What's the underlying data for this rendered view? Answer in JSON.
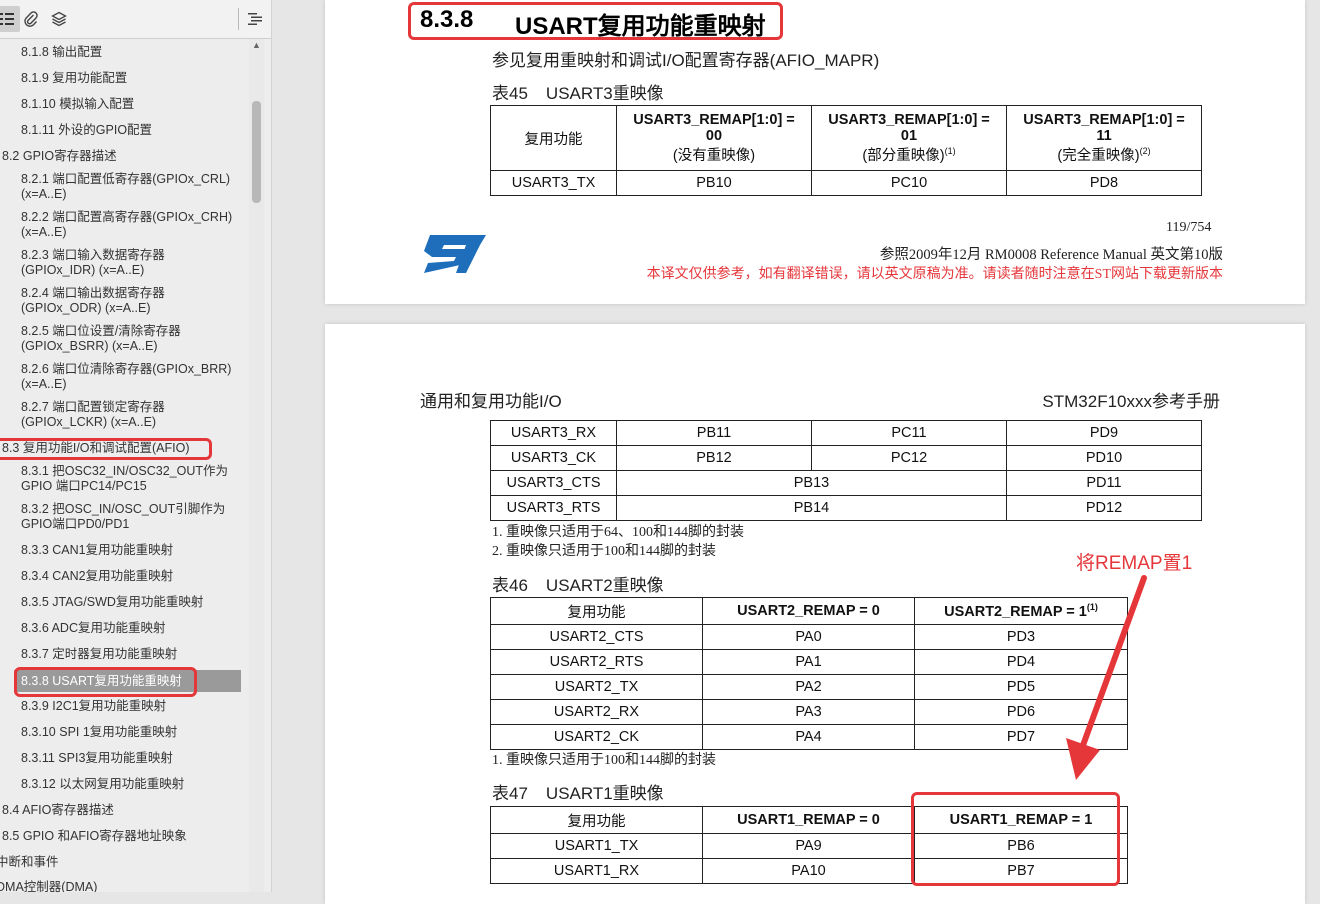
{
  "toolbar": {
    "icons": [
      "list-icon",
      "paperclip-icon",
      "layers-icon",
      "outline-options-icon"
    ]
  },
  "outline": {
    "items": [
      {
        "label": "8.1.8 输出配置"
      },
      {
        "label": "8.1.9 复用功能配置"
      },
      {
        "label": "8.1.10 模拟输入配置"
      },
      {
        "label": "8.1.11 外设的GPIO配置"
      },
      {
        "label": "8.2 GPIO寄存器描述"
      },
      {
        "label": "8.2.1 端口配置低寄存器(GPIOx_CRL)",
        "label2": "(x=A..E)"
      },
      {
        "label": "8.2.2 端口配置高寄存器(GPIOx_CRH)",
        "label2": "(x=A..E)"
      },
      {
        "label": "8.2.3 端口输入数据寄存器",
        "label2": "(GPIOx_IDR) (x=A..E)"
      },
      {
        "label": "8.2.4 端口输出数据寄存器",
        "label2": "(GPIOx_ODR) (x=A..E)"
      },
      {
        "label": "8.2.5 端口位设置/清除寄存器",
        "label2": "(GPIOx_BSRR) (x=A..E)"
      },
      {
        "label": "8.2.6 端口位清除寄存器(GPIOx_BRR)",
        "label2": "(x=A..E)"
      },
      {
        "label": "8.2.7 端口配置锁定寄存器",
        "label2": "(GPIOx_LCKR) (x=A..E)"
      },
      {
        "label": "8.3 复用功能I/O和调试配置(AFIO)"
      },
      {
        "label": "8.3.1 把OSC32_IN/OSC32_OUT作为",
        "label2": "GPIO 端口PC14/PC15"
      },
      {
        "label": "8.3.2 把OSC_IN/OSC_OUT引脚作为",
        "label2": "GPIO端口PD0/PD1"
      },
      {
        "label": "8.3.3 CAN1复用功能重映射"
      },
      {
        "label": "8.3.4 CAN2复用功能重映射"
      },
      {
        "label": "8.3.5 JTAG/SWD复用功能重映射"
      },
      {
        "label": "8.3.6 ADC复用功能重映射"
      },
      {
        "label": "8.3.7 定时器复用功能重映射"
      },
      {
        "label": "8.3.8 USART复用功能重映射"
      },
      {
        "label": "8.3.9 I2C1复用功能重映射"
      },
      {
        "label": "8.3.10 SPI 1复用功能重映射"
      },
      {
        "label": "8.3.11 SPI3复用功能重映射"
      },
      {
        "label": "8.3.12 以太网复用功能重映射"
      },
      {
        "label": "8.4 AFIO寄存器描述"
      },
      {
        "label": "8.5 GPIO 和AFIO寄存器地址映象"
      },
      {
        "label": "中断和事件"
      },
      {
        "label": "DMA控制器(DMA)"
      }
    ]
  },
  "page1": {
    "section_number": "8.3.8",
    "section_title": "USART复用功能重映射",
    "ref_text": "参见复用重映射和调试I/O配置寄存器(AFIO_MAPR)",
    "table45_caption_num": "表45",
    "table45_caption": "USART3重映像",
    "table45": {
      "headers": [
        {
          "l1": "复用功能",
          "l2": "",
          "l3": "",
          "sup": ""
        },
        {
          "l1": "USART3_REMAP[1:0] =",
          "l2": "00",
          "l3": "(没有重映像)",
          "sup": ""
        },
        {
          "l1": "USART3_REMAP[1:0] =",
          "l2": "01",
          "l3": "(部分重映像)",
          "sup": "(1)"
        },
        {
          "l1": "USART3_REMAP[1:0] =",
          "l2": "11",
          "l3": "(完全重映像)",
          "sup": "(2)"
        }
      ],
      "rows": [
        [
          "USART3_TX",
          "PB10",
          "PC10",
          "PD8"
        ]
      ]
    },
    "page_number": "119/754",
    "footer_line": "参照2009年12月 RM0008 Reference Manual  英文第10版",
    "footer_disclaimer": "本译文仅供参考，如有翻译错误，请以英文原稿为准。请读者随时注意在ST网站下载更新版本"
  },
  "page2": {
    "header_left": "通用和复用功能I/O",
    "header_right": "STM32F10xxx参考手册",
    "table45_cont": [
      [
        "USART3_RX",
        "PB11",
        "PC11",
        "PD9"
      ],
      [
        "USART3_CK",
        "PB12",
        "PC12",
        "PD10"
      ],
      [
        "USART3_CTS",
        "PB13",
        "PD11"
      ],
      [
        "USART3_RTS",
        "PB14",
        "PD12"
      ]
    ],
    "notes45": [
      "1.  重映像只适用于64、100和144脚的封装",
      "2.  重映像只适用于100和144脚的封装"
    ],
    "annotation": "将REMAP置1",
    "table46_caption_num": "表46",
    "table46_caption": "USART2重映像",
    "table46": {
      "headers": [
        "复用功能",
        "USART2_REMAP = 0",
        "USART2_REMAP = 1"
      ],
      "header_sup": "(1)",
      "rows": [
        [
          "USART2_CTS",
          "PA0",
          "PD3"
        ],
        [
          "USART2_RTS",
          "PA1",
          "PD4"
        ],
        [
          "USART2_TX",
          "PA2",
          "PD5"
        ],
        [
          "USART2_RX",
          "PA3",
          "PD6"
        ],
        [
          "USART2_CK",
          "PA4",
          "PD7"
        ]
      ]
    },
    "notes46": [
      "1.  重映像只适用于100和144脚的封装"
    ],
    "table47_caption_num": "表47",
    "table47_caption": "USART1重映像",
    "table47": {
      "headers": [
        "复用功能",
        "USART1_REMAP = 0",
        "USART1_REMAP = 1"
      ],
      "rows": [
        [
          "USART1_TX",
          "PA9",
          "PB6"
        ],
        [
          "USART1_RX",
          "PA10",
          "PB7"
        ]
      ]
    }
  },
  "colors": {
    "highlight": "#e5363a",
    "st_logo": "#1f6ebb",
    "selected_bg": "#9a9a9a"
  }
}
